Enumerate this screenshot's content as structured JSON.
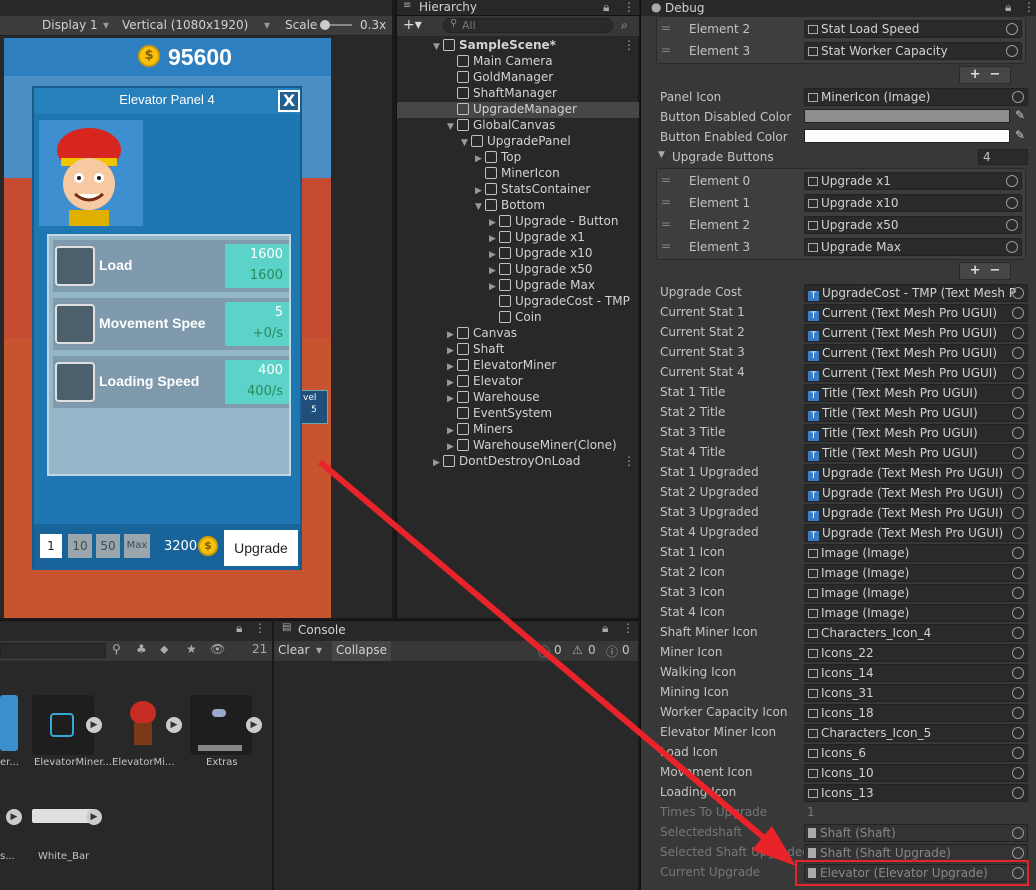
{
  "game": {
    "display": "Display 1",
    "resolution": "Vertical (1080x1920)",
    "scale_label": "Scale",
    "scale_value": "0.3x",
    "gold": "95600",
    "panel_title": "Elevator Panel 4",
    "close": "X",
    "stats": [
      {
        "name": "Load",
        "v1": "1600",
        "v2": "1600"
      },
      {
        "name": "Movement Spee",
        "v1": "5",
        "v2": "+0/s"
      },
      {
        "name": "Loading Speed",
        "v1": "400",
        "v2": "400/s"
      }
    ],
    "multipliers": [
      "1",
      "10",
      "50",
      "Max"
    ],
    "cost": "3200",
    "upgrade_button": "Upgrade",
    "level_badge": "vel",
    "level_num": "5"
  },
  "hierarchy": {
    "tab": "Hierarchy",
    "search_placeholder": "All",
    "items": [
      {
        "label": "SampleScene*",
        "indent": 0,
        "arrow": "▼",
        "bold": true
      },
      {
        "label": "Main Camera",
        "indent": 1,
        "arrow": ""
      },
      {
        "label": "GoldManager",
        "indent": 1,
        "arrow": ""
      },
      {
        "label": "ShaftManager",
        "indent": 1,
        "arrow": ""
      },
      {
        "label": "UpgradeManager",
        "indent": 1,
        "arrow": "",
        "selected": true
      },
      {
        "label": "GlobalCanvas",
        "indent": 1,
        "arrow": "▼"
      },
      {
        "label": "UpgradePanel",
        "indent": 2,
        "arrow": "▼"
      },
      {
        "label": "Top",
        "indent": 3,
        "arrow": "▶"
      },
      {
        "label": "MinerIcon",
        "indent": 3,
        "arrow": ""
      },
      {
        "label": "StatsContainer",
        "indent": 3,
        "arrow": "▶"
      },
      {
        "label": "Bottom",
        "indent": 3,
        "arrow": "▼"
      },
      {
        "label": "Upgrade - Button",
        "indent": 4,
        "arrow": "▶"
      },
      {
        "label": "Upgrade x1",
        "indent": 4,
        "arrow": "▶"
      },
      {
        "label": "Upgrade x10",
        "indent": 4,
        "arrow": "▶"
      },
      {
        "label": "Upgrade x50",
        "indent": 4,
        "arrow": "▶"
      },
      {
        "label": "Upgrade Max",
        "indent": 4,
        "arrow": "▶"
      },
      {
        "label": "UpgradeCost - TMP",
        "indent": 4,
        "arrow": ""
      },
      {
        "label": "Coin",
        "indent": 4,
        "arrow": ""
      },
      {
        "label": "Canvas",
        "indent": 1,
        "arrow": "▶"
      },
      {
        "label": "Shaft",
        "indent": 1,
        "arrow": "▶"
      },
      {
        "label": "ElevatorMiner",
        "indent": 1,
        "arrow": "▶"
      },
      {
        "label": "Elevator",
        "indent": 1,
        "arrow": "▶"
      },
      {
        "label": "Warehouse",
        "indent": 1,
        "arrow": "▶"
      },
      {
        "label": "EventSystem",
        "indent": 1,
        "arrow": ""
      },
      {
        "label": "Miners",
        "indent": 1,
        "arrow": "▶"
      },
      {
        "label": "WarehouseMiner(Clone)",
        "indent": 1,
        "arrow": "▶"
      },
      {
        "label": "DontDestroyOnLoad",
        "indent": 0,
        "arrow": "▶"
      }
    ]
  },
  "project": {
    "count": "21",
    "assets": [
      "ElevatorMiner...",
      "ElevatorMi...",
      "Extras",
      "White_Bar"
    ],
    "partial_asset_1": "er...",
    "partial_asset_2": "s..."
  },
  "console": {
    "tab": "Console",
    "clear": "Clear",
    "collapse": "Collapse",
    "counts": [
      "0",
      "0",
      "0"
    ]
  },
  "debug": {
    "tab": "Debug",
    "top_elements": [
      {
        "label": "Element 2",
        "value": "Stat Load Speed"
      },
      {
        "label": "Element 3",
        "value": "Stat Worker Capacity"
      }
    ],
    "panel_icon": {
      "label": "Panel Icon",
      "value": "MinerIcon (Image)"
    },
    "button_disabled": "Button Disabled Color",
    "button_enabled": "Button Enabled Color",
    "upgrade_buttons": {
      "label": "Upgrade Buttons",
      "count": "4"
    },
    "button_elements": [
      {
        "label": "Element 0",
        "value": "Upgrade x1"
      },
      {
        "label": "Element 1",
        "value": "Upgrade x10"
      },
      {
        "label": "Element 2",
        "value": "Upgrade x50"
      },
      {
        "label": "Element 3",
        "value": "Upgrade Max"
      }
    ],
    "fields": [
      {
        "label": "Upgrade Cost",
        "value": "UpgradeCost - TMP (Text Mesh P",
        "kind": "tmp"
      },
      {
        "label": "Current Stat 1",
        "value": "Current (Text Mesh Pro UGUI)",
        "kind": "tmp"
      },
      {
        "label": "Current Stat 2",
        "value": "Current (Text Mesh Pro UGUI)",
        "kind": "tmp"
      },
      {
        "label": "Current Stat 3",
        "value": "Current (Text Mesh Pro UGUI)",
        "kind": "tmp"
      },
      {
        "label": "Current Stat 4",
        "value": "Current (Text Mesh Pro UGUI)",
        "kind": "tmp"
      },
      {
        "label": "Stat 1 Title",
        "value": "Title (Text Mesh Pro UGUI)",
        "kind": "tmp"
      },
      {
        "label": "Stat 2 Title",
        "value": "Title (Text Mesh Pro UGUI)",
        "kind": "tmp"
      },
      {
        "label": "Stat 3 Title",
        "value": "Title (Text Mesh Pro UGUI)",
        "kind": "tmp"
      },
      {
        "label": "Stat 4 Title",
        "value": "Title (Text Mesh Pro UGUI)",
        "kind": "tmp"
      },
      {
        "label": "Stat 1 Upgraded",
        "value": "Upgrade (Text Mesh Pro UGUI)",
        "kind": "tmp"
      },
      {
        "label": "Stat 2 Upgraded",
        "value": "Upgrade (Text Mesh Pro UGUI)",
        "kind": "tmp"
      },
      {
        "label": "Stat 3 Upgraded",
        "value": "Upgrade (Text Mesh Pro UGUI)",
        "kind": "tmp"
      },
      {
        "label": "Stat 4 Upgraded",
        "value": "Upgrade (Text Mesh Pro UGUI)",
        "kind": "tmp"
      },
      {
        "label": "Stat 1 Icon",
        "value": "Image (Image)",
        "kind": "img"
      },
      {
        "label": "Stat 2 Icon",
        "value": "Image (Image)",
        "kind": "img"
      },
      {
        "label": "Stat 3 Icon",
        "value": "Image (Image)",
        "kind": "img"
      },
      {
        "label": "Stat 4 Icon",
        "value": "Image (Image)",
        "kind": "img"
      },
      {
        "label": "Shaft Miner Icon",
        "value": "Characters_Icon_4",
        "kind": "sprite"
      },
      {
        "label": "Miner Icon",
        "value": "Icons_22",
        "kind": "sprite"
      },
      {
        "label": "Walking Icon",
        "value": "Icons_14",
        "kind": "sprite"
      },
      {
        "label": "Mining Icon",
        "value": "Icons_31",
        "kind": "sprite"
      },
      {
        "label": "Worker Capacity Icon",
        "value": "Icons_18",
        "kind": "sprite"
      },
      {
        "label": "Elevator Miner Icon",
        "value": "Characters_Icon_5",
        "kind": "sprite"
      },
      {
        "label": "Load Icon",
        "value": "Icons_6",
        "kind": "sprite"
      },
      {
        "label": "Movement Icon",
        "value": "Icons_10",
        "kind": "sprite"
      },
      {
        "label": "Loading Icon",
        "value": "Icons_13",
        "kind": "sprite"
      }
    ],
    "times_to_upgrade": {
      "label": "Times To Upgrade",
      "value": "1"
    },
    "faded_fields": [
      {
        "label": "Selectedshaft",
        "value": "Shaft (Shaft)"
      },
      {
        "label": "Selected Shaft Upgraded",
        "value": "Shaft (Shaft Upgrade)"
      },
      {
        "label": "Current Upgrade",
        "value": "Elevator (Elevator Upgrade)"
      }
    ]
  },
  "colors": {
    "accent_red": "#e8242a",
    "panel_blue": "#1f77b2",
    "stat_teal": "#5cd3c8"
  }
}
